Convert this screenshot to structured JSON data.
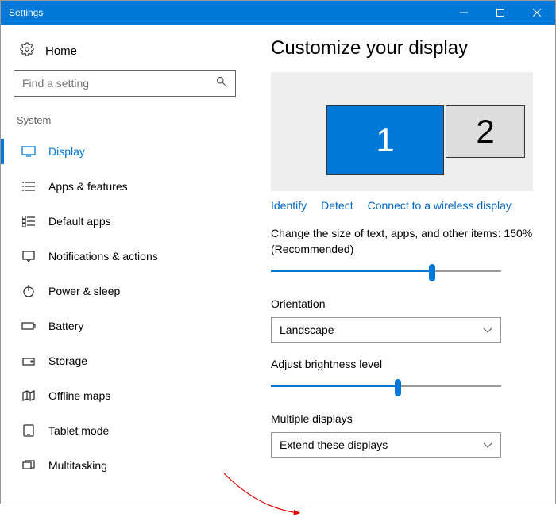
{
  "window": {
    "title": "Settings"
  },
  "sidebar": {
    "home": "Home",
    "search_placeholder": "Find a setting",
    "section": "System",
    "items": [
      {
        "label": "Display"
      },
      {
        "label": "Apps & features"
      },
      {
        "label": "Default apps"
      },
      {
        "label": "Notifications & actions"
      },
      {
        "label": "Power & sleep"
      },
      {
        "label": "Battery"
      },
      {
        "label": "Storage"
      },
      {
        "label": "Offline maps"
      },
      {
        "label": "Tablet mode"
      },
      {
        "label": "Multitasking"
      }
    ]
  },
  "main": {
    "title": "Customize your display",
    "monitor1": "1",
    "monitor2": "2",
    "links": {
      "identify": "Identify",
      "detect": "Detect",
      "wireless": "Connect to a wireless display"
    },
    "scale_label": "Change the size of text, apps, and other items: 150% (Recommended)",
    "scale_percent": 70,
    "orientation_label": "Orientation",
    "orientation_value": "Landscape",
    "brightness_label": "Adjust brightness level",
    "brightness_percent": 55,
    "multi_label": "Multiple displays",
    "multi_value": "Extend these displays"
  }
}
